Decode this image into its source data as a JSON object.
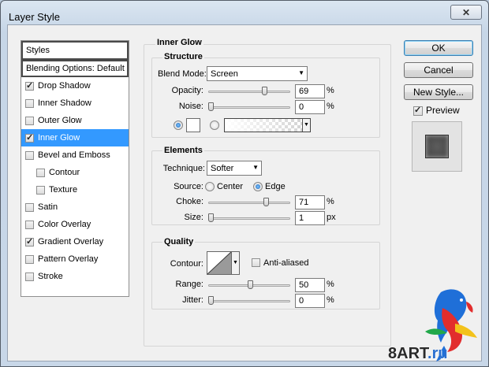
{
  "window": {
    "title": "Layer Style",
    "close": "✕"
  },
  "sidebar": {
    "items": [
      {
        "label": "Styles",
        "checkbox": false
      },
      {
        "label": "Blending Options: Default",
        "checkbox": false
      },
      {
        "label": "Drop Shadow",
        "checkbox": true,
        "checked": true
      },
      {
        "label": "Inner Shadow",
        "checkbox": true,
        "checked": false
      },
      {
        "label": "Outer Glow",
        "checkbox": true,
        "checked": false
      },
      {
        "label": "Inner Glow",
        "checkbox": true,
        "checked": true,
        "selected": true
      },
      {
        "label": "Bevel and Emboss",
        "checkbox": true,
        "checked": false
      },
      {
        "label": "Contour",
        "checkbox": true,
        "checked": false,
        "indent": true
      },
      {
        "label": "Texture",
        "checkbox": true,
        "checked": false,
        "indent": true
      },
      {
        "label": "Satin",
        "checkbox": true,
        "checked": false
      },
      {
        "label": "Color Overlay",
        "checkbox": true,
        "checked": false
      },
      {
        "label": "Gradient Overlay",
        "checkbox": true,
        "checked": true
      },
      {
        "label": "Pattern Overlay",
        "checkbox": true,
        "checked": false
      },
      {
        "label": "Stroke",
        "checkbox": true,
        "checked": false
      }
    ]
  },
  "panel": {
    "title": "Inner Glow",
    "structure": {
      "title": "Structure",
      "blend_mode_label": "Blend Mode:",
      "blend_mode_value": "Screen",
      "opacity_label": "Opacity:",
      "opacity_value": "69",
      "opacity_unit": "%",
      "noise_label": "Noise:",
      "noise_value": "0",
      "noise_unit": "%"
    },
    "elements": {
      "title": "Elements",
      "technique_label": "Technique:",
      "technique_value": "Softer",
      "source_label": "Source:",
      "source_center": "Center",
      "source_edge": "Edge",
      "choke_label": "Choke:",
      "choke_value": "71",
      "choke_unit": "%",
      "size_label": "Size:",
      "size_value": "1",
      "size_unit": "px"
    },
    "quality": {
      "title": "Quality",
      "contour_label": "Contour:",
      "anti_aliased_label": "Anti-aliased",
      "range_label": "Range:",
      "range_value": "50",
      "range_unit": "%",
      "jitter_label": "Jitter:",
      "jitter_value": "0",
      "jitter_unit": "%"
    }
  },
  "buttons": {
    "ok": "OK",
    "cancel": "Cancel",
    "new_style": "New Style...",
    "preview": "Preview"
  },
  "watermark": {
    "brand": "8ART",
    "domain": ".ru"
  },
  "colors": {
    "selection": "#3399ff",
    "radio_on": "#1d63b8"
  }
}
